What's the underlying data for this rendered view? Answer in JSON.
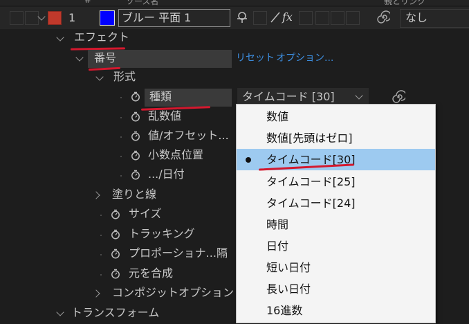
{
  "header": {
    "col1": "#",
    "col2": "ソース名",
    "col3": "親とリンク"
  },
  "layer": {
    "number": "1",
    "name": "ブルー 平面 1",
    "parent_value": "なし",
    "label_color": "#c0392b",
    "swatch_color": "#0000ff"
  },
  "tree": {
    "effect": "エフェクト",
    "number_effect": "番号",
    "reset": "リセット",
    "options": "オプション...",
    "format": "形式",
    "type": "種類",
    "type_value": "タイムコード [30]",
    "random": "乱数値",
    "value_offset": "値/オフセット...",
    "decimal": "小数点位置",
    "date": ".../日付",
    "fill_stroke": "塗りと線",
    "size": "サイズ",
    "tracking": "トラッキング",
    "proportional": "プロポーショナ...隔",
    "composite_original": "元を合成",
    "composite_options": "コンポジットオプション",
    "transform": "トランスフォーム"
  },
  "menu": {
    "items": [
      {
        "label": "数値"
      },
      {
        "label": "数値[先頭はゼロ]"
      },
      {
        "label": "タイムコード[30]",
        "selected": true
      },
      {
        "label": "タイムコード[25]"
      },
      {
        "label": "タイムコード[24]"
      },
      {
        "label": "時間"
      },
      {
        "label": "日付"
      },
      {
        "label": "短い日付"
      },
      {
        "label": "長い日付"
      },
      {
        "label": "16進数"
      }
    ]
  },
  "colors": {
    "annotation_red": "#d4182e",
    "link_blue": "#3d8ee0",
    "menu_selection": "#9dcaf0"
  }
}
